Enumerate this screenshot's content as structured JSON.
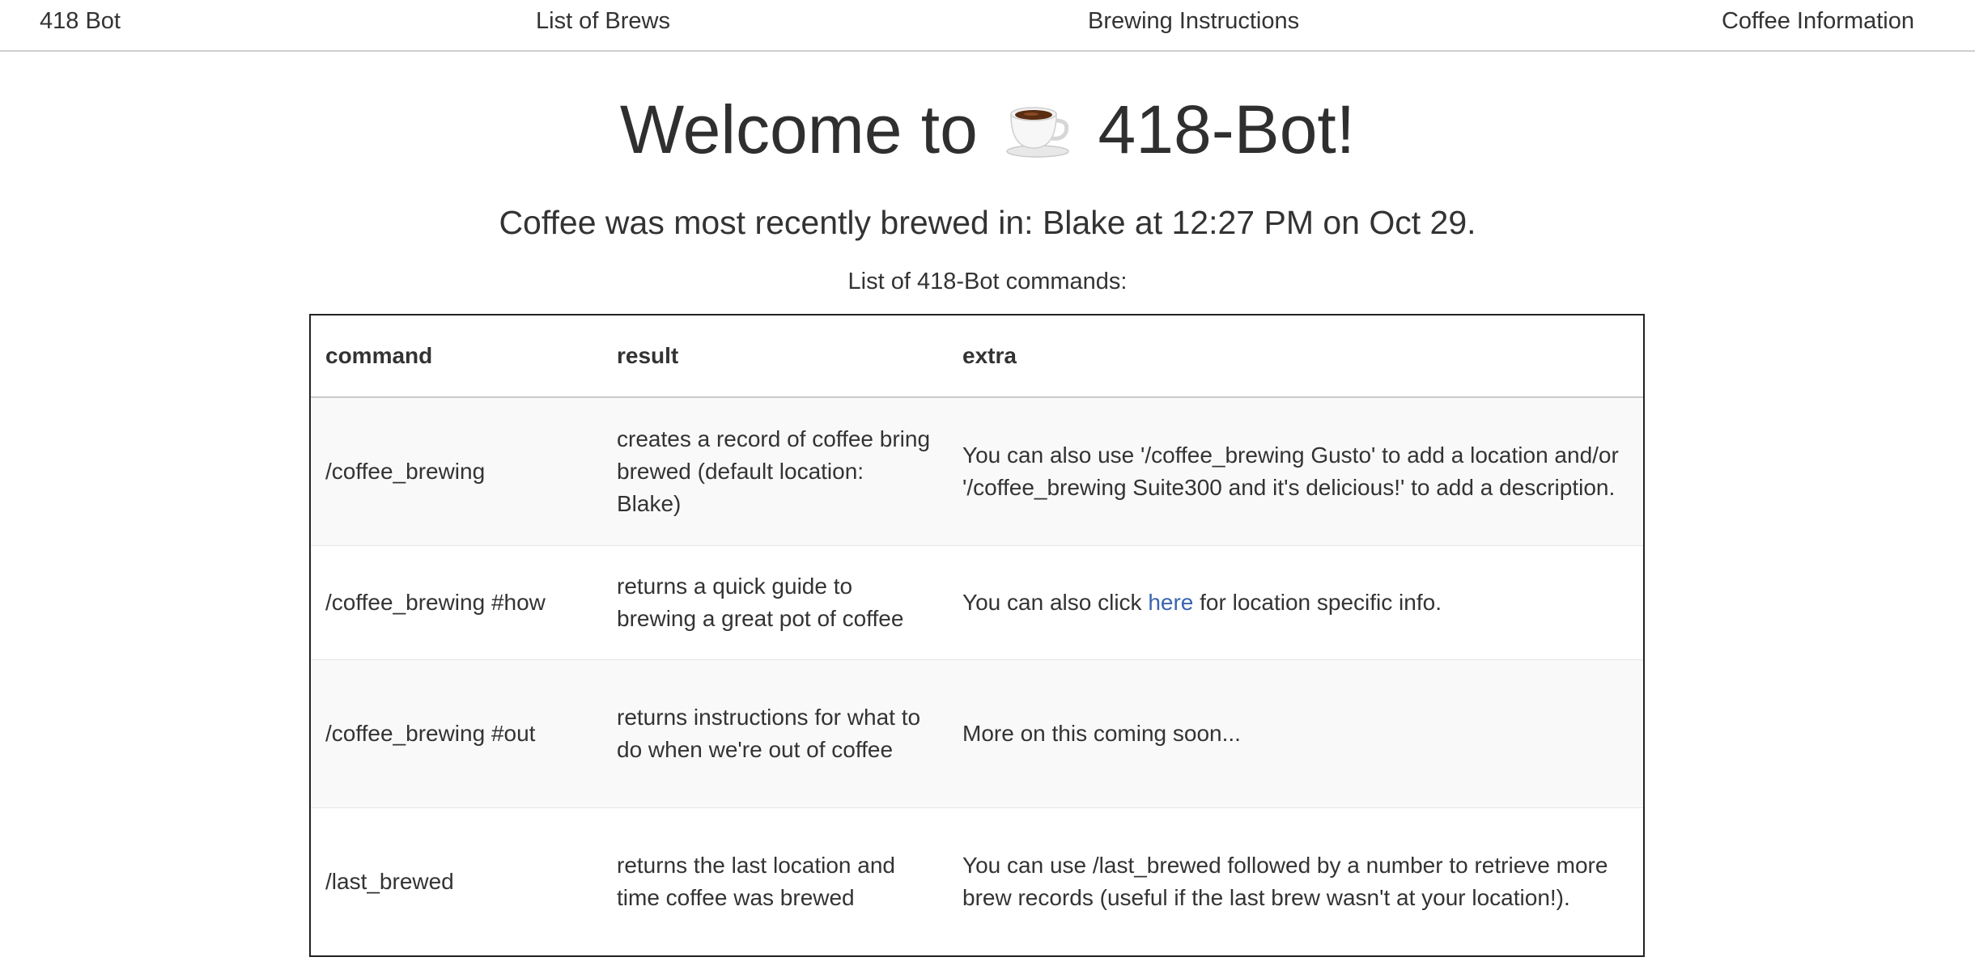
{
  "nav": {
    "brand": "418 Bot",
    "brews": "List of Brews",
    "instructions": "Brewing Instructions",
    "info": "Coffee Information"
  },
  "hero": {
    "prefix": "Welcome to",
    "icon": "coffee-cup-icon",
    "suffix": "418-Bot!"
  },
  "status": "Coffee was most recently brewed in: Blake at 12:27 PM on Oct 29.",
  "commands_heading": "List of 418-Bot commands:",
  "table": {
    "headers": [
      "command",
      "result",
      "extra"
    ],
    "rows": [
      {
        "command": "/coffee_brewing",
        "result": "creates a record of coffee bring brewed (default location: Blake)",
        "extra": "You can also use '/coffee_brewing Gusto' to add a location and/or '/coffee_brewing Suite300 and it's delicious!' to add a description."
      },
      {
        "command": "/coffee_brewing #how",
        "result": "returns a quick guide to brewing a great pot of coffee",
        "extra_before": "You can also click",
        "extra_link": "here",
        "extra_after": "for location specific info."
      },
      {
        "command": "/coffee_brewing #out",
        "result": "returns instructions for what to do when we're out of coffee",
        "extra": "More on this coming soon..."
      },
      {
        "command": "/last_brewed",
        "result": "returns the last location and time coffee was brewed",
        "extra": "You can use /last_brewed followed by a number to retrieve more brew records (useful if the last brew wasn't at your location!)."
      }
    ]
  },
  "colors": {
    "text": "#333333",
    "link": "#3a64b0",
    "stripe": "#f9f9f9",
    "border": "#222222"
  }
}
